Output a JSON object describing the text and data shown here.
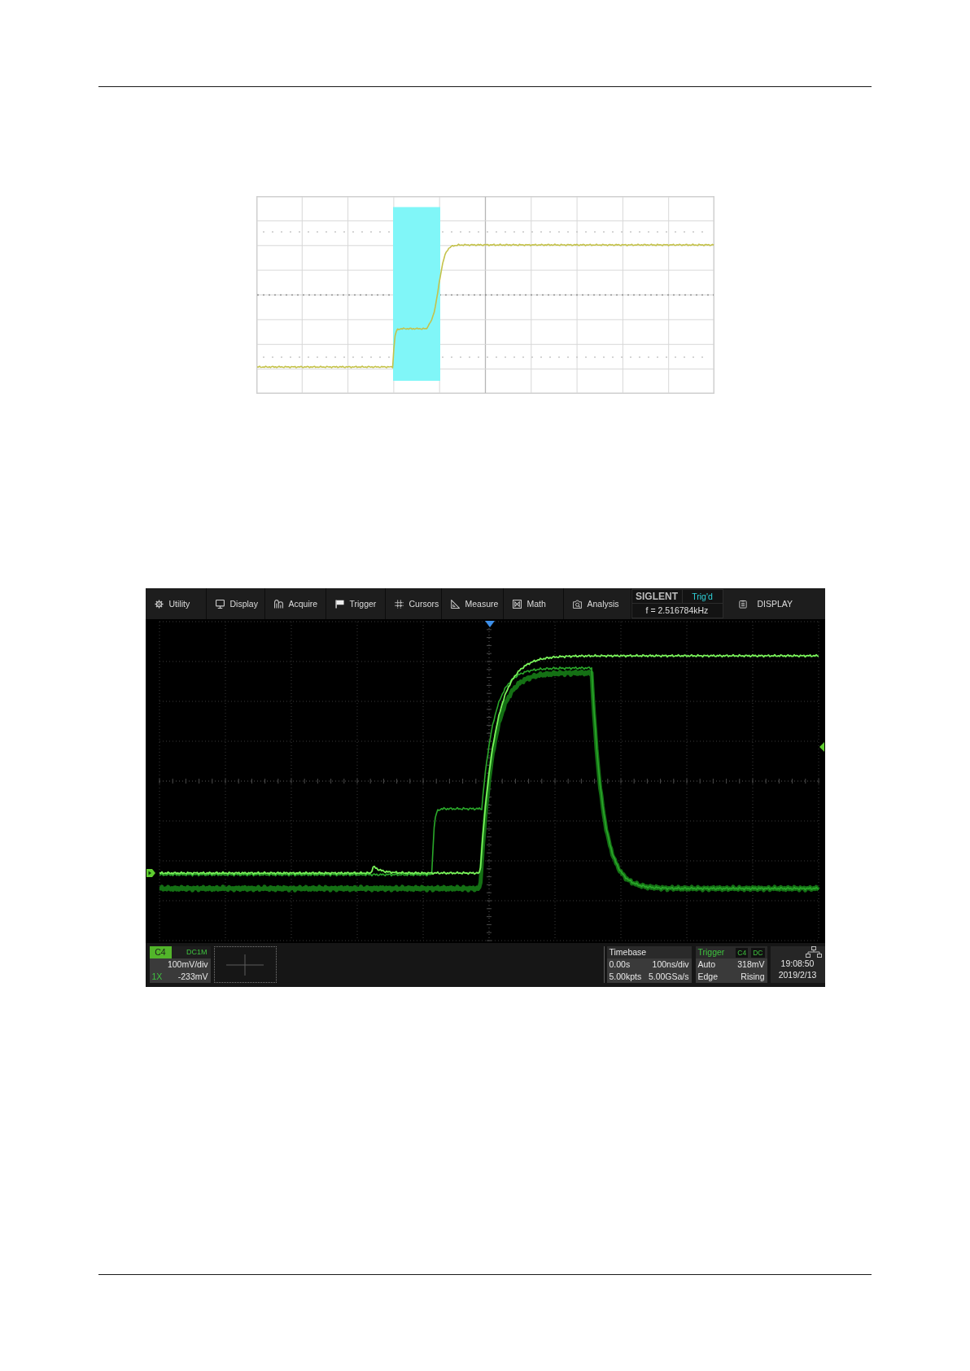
{
  "scope": {
    "menu": [
      "Utility",
      "Display",
      "Acquire",
      "Trigger",
      "Cursors",
      "Measure",
      "Math",
      "Analysis"
    ],
    "brand": "SIGLENT",
    "trigger_status": "Trig'd",
    "frequency": "f = 2.516784kHz",
    "panel_menu": "DISPLAY",
    "channel": {
      "name": "C4",
      "coupling": "DC1M",
      "scale": "100mV/div",
      "probe": "1X",
      "offset": "-233mV"
    },
    "timebase": {
      "title": "Timebase",
      "delay": "0.00s",
      "scale": "100ns/div",
      "memory_depth": "5.00kpts",
      "sample_rate": "5.00GSa/s"
    },
    "trigger": {
      "title": "Trigger",
      "source": "C4",
      "coupling": "DC",
      "mode": "Auto",
      "trigger_level": "318mV",
      "trigger_type": "Edge",
      "slope": "Rising"
    },
    "clock": {
      "time": "19:08:50",
      "date": "2019/2/13"
    }
  }
}
